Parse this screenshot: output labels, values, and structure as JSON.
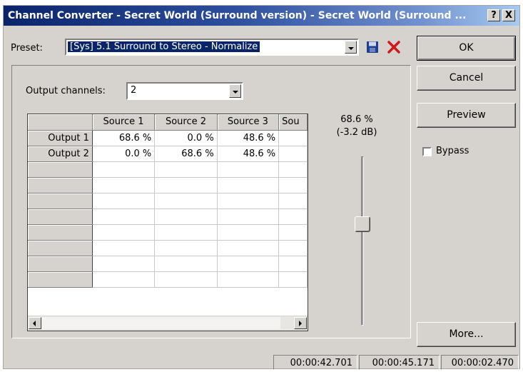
{
  "window": {
    "title": "Channel Converter - Secret World (Surround version) - Secret World (Surround ...",
    "help_label": "?",
    "close_label": "X"
  },
  "preset": {
    "label": "Preset:",
    "value": "[Sys] 5.1 Surround to Stereo - Normalize",
    "save_icon": "floppy-disk-icon",
    "delete_icon": "red-x-icon"
  },
  "output": {
    "label": "Output channels:",
    "value": "2"
  },
  "grid": {
    "columns": [
      "Source 1",
      "Source 2",
      "Source 3",
      "Sou"
    ],
    "rows": [
      {
        "label": "Output 1",
        "cells": [
          "68.6 %",
          "0.0 %",
          "48.6 %",
          ""
        ]
      },
      {
        "label": "Output 2",
        "cells": [
          "0.0 %",
          "68.6 %",
          "48.6 %",
          ""
        ]
      }
    ],
    "empty_rows": 8
  },
  "slider": {
    "percent_label": "68.6 %",
    "db_label": "(-3.2 dB)",
    "level_fraction": 0.6
  },
  "buttons": {
    "ok": "OK",
    "cancel": "Cancel",
    "preview": "Preview",
    "more": "More..."
  },
  "bypass": {
    "label": "Bypass",
    "checked": false
  },
  "status": {
    "start": "00:00:42.701",
    "end": "00:00:45.171",
    "length": "00:00:02.470"
  }
}
